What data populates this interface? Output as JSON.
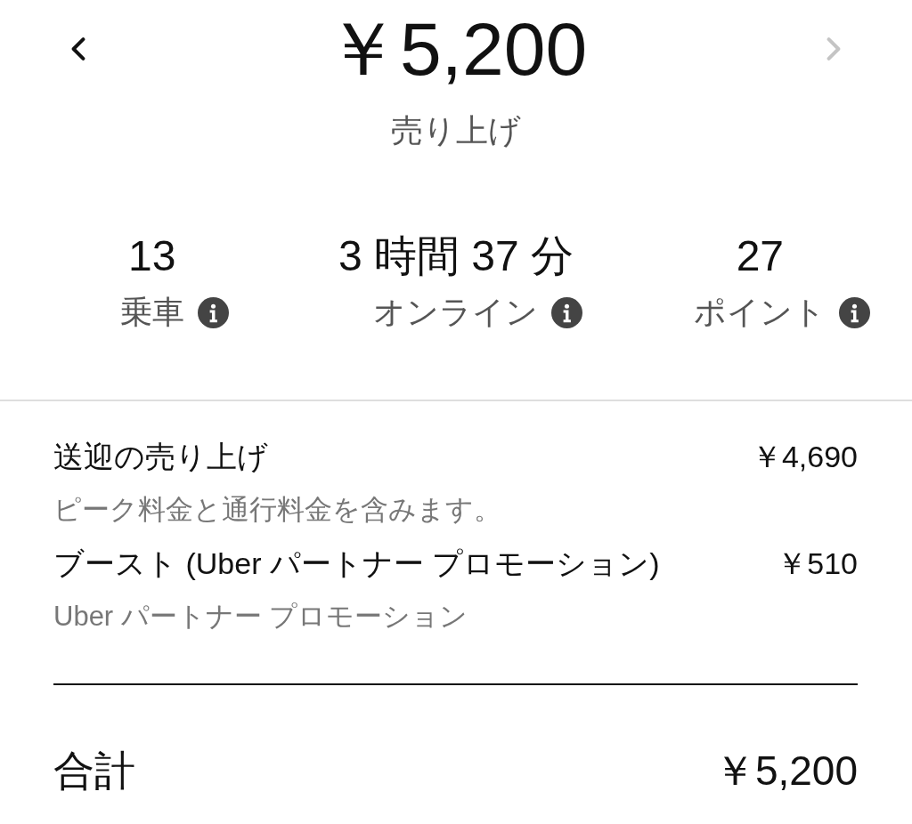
{
  "header": {
    "back_button": {
      "disabled": false
    },
    "forward_button": {
      "disabled": true
    },
    "amount": "￥5,200",
    "caption": "売り上げ"
  },
  "stats": [
    {
      "value": "13",
      "label": "乗車"
    },
    {
      "value": "3 時間 37 分",
      "label": "オンライン"
    },
    {
      "value": "27",
      "label": "ポイント"
    }
  ],
  "line_items": [
    {
      "title": "送迎の売り上げ",
      "amount": "￥4,690",
      "note": "ピーク料金と通行料金を含みます。"
    },
    {
      "title": "ブースト (Uber パートナー プロモーション)",
      "amount": "￥510",
      "note": "Uber パートナー プロモーション"
    }
  ],
  "total": {
    "label": "合計",
    "amount": "￥5,200"
  }
}
